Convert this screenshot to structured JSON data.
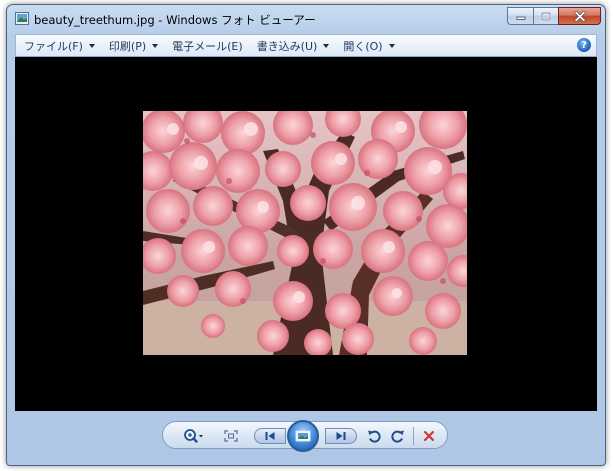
{
  "window": {
    "title": "beauty_treethum.jpg - Windows フォト ビューアー"
  },
  "menu": {
    "items": [
      {
        "label": "ファイル(F)",
        "has_dropdown": true
      },
      {
        "label": "印刷(P)",
        "has_dropdown": true
      },
      {
        "label": "電子メール(E)",
        "has_dropdown": false
      },
      {
        "label": "書き込み(U)",
        "has_dropdown": true
      },
      {
        "label": "開く(O)",
        "has_dropdown": true
      }
    ],
    "help_glyph": "?"
  },
  "toolbar": {
    "icons": [
      "zoom-icon",
      "actual-size-icon",
      "previous-icon",
      "slideshow-icon",
      "next-icon",
      "rotate-counterclockwise-icon",
      "rotate-clockwise-icon",
      "delete-icon"
    ]
  },
  "colors": {
    "viewer_bg": "#000000",
    "delete_red": "#d0302a",
    "accent_blue": "#2c5b97"
  }
}
